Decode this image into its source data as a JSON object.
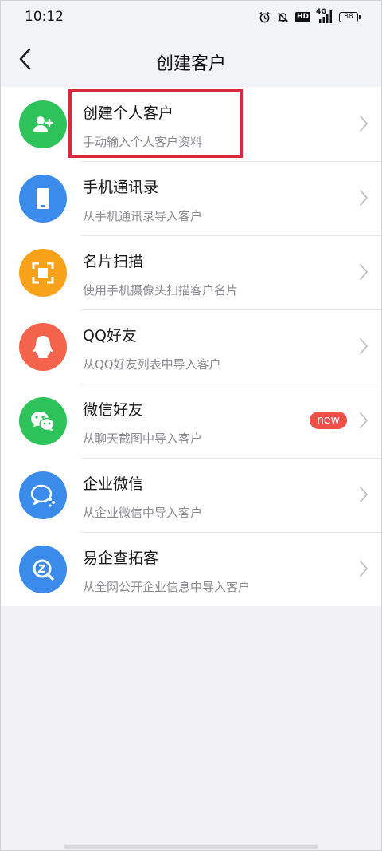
{
  "status_bar": {
    "time": "10:12",
    "network_label": "4G",
    "hd_label": "HD",
    "battery": "88"
  },
  "nav": {
    "title": "创建客户"
  },
  "items": [
    {
      "title": "创建个人客户",
      "subtitle": "手动输入个人客户资料",
      "icon": "add-person-icon",
      "color": "#2dc25a"
    },
    {
      "title": "手机通讯录",
      "subtitle": "从手机通讯录导入客户",
      "icon": "phone-icon",
      "color": "#3b8beb"
    },
    {
      "title": "名片扫描",
      "subtitle": "使用手机摄像头扫描客户名片",
      "icon": "scan-icon",
      "color": "#f8a21a"
    },
    {
      "title": "QQ好友",
      "subtitle": "从QQ好友列表中导入客户",
      "icon": "qq-icon",
      "color": "#f4634c"
    },
    {
      "title": "微信好友",
      "subtitle": "从聊天截图中导入客户",
      "icon": "wechat-icon",
      "color": "#2dc25a",
      "badge": "new"
    },
    {
      "title": "企业微信",
      "subtitle": "从企业微信中导入客户",
      "icon": "wecom-icon",
      "color": "#3b8beb"
    },
    {
      "title": "易企查拓客",
      "subtitle": "从全网公开企业信息中导入客户",
      "icon": "search-company-icon",
      "color": "#3b8beb"
    }
  ],
  "colors": {
    "highlight": "#d8293f",
    "badge": "#f0504a"
  }
}
